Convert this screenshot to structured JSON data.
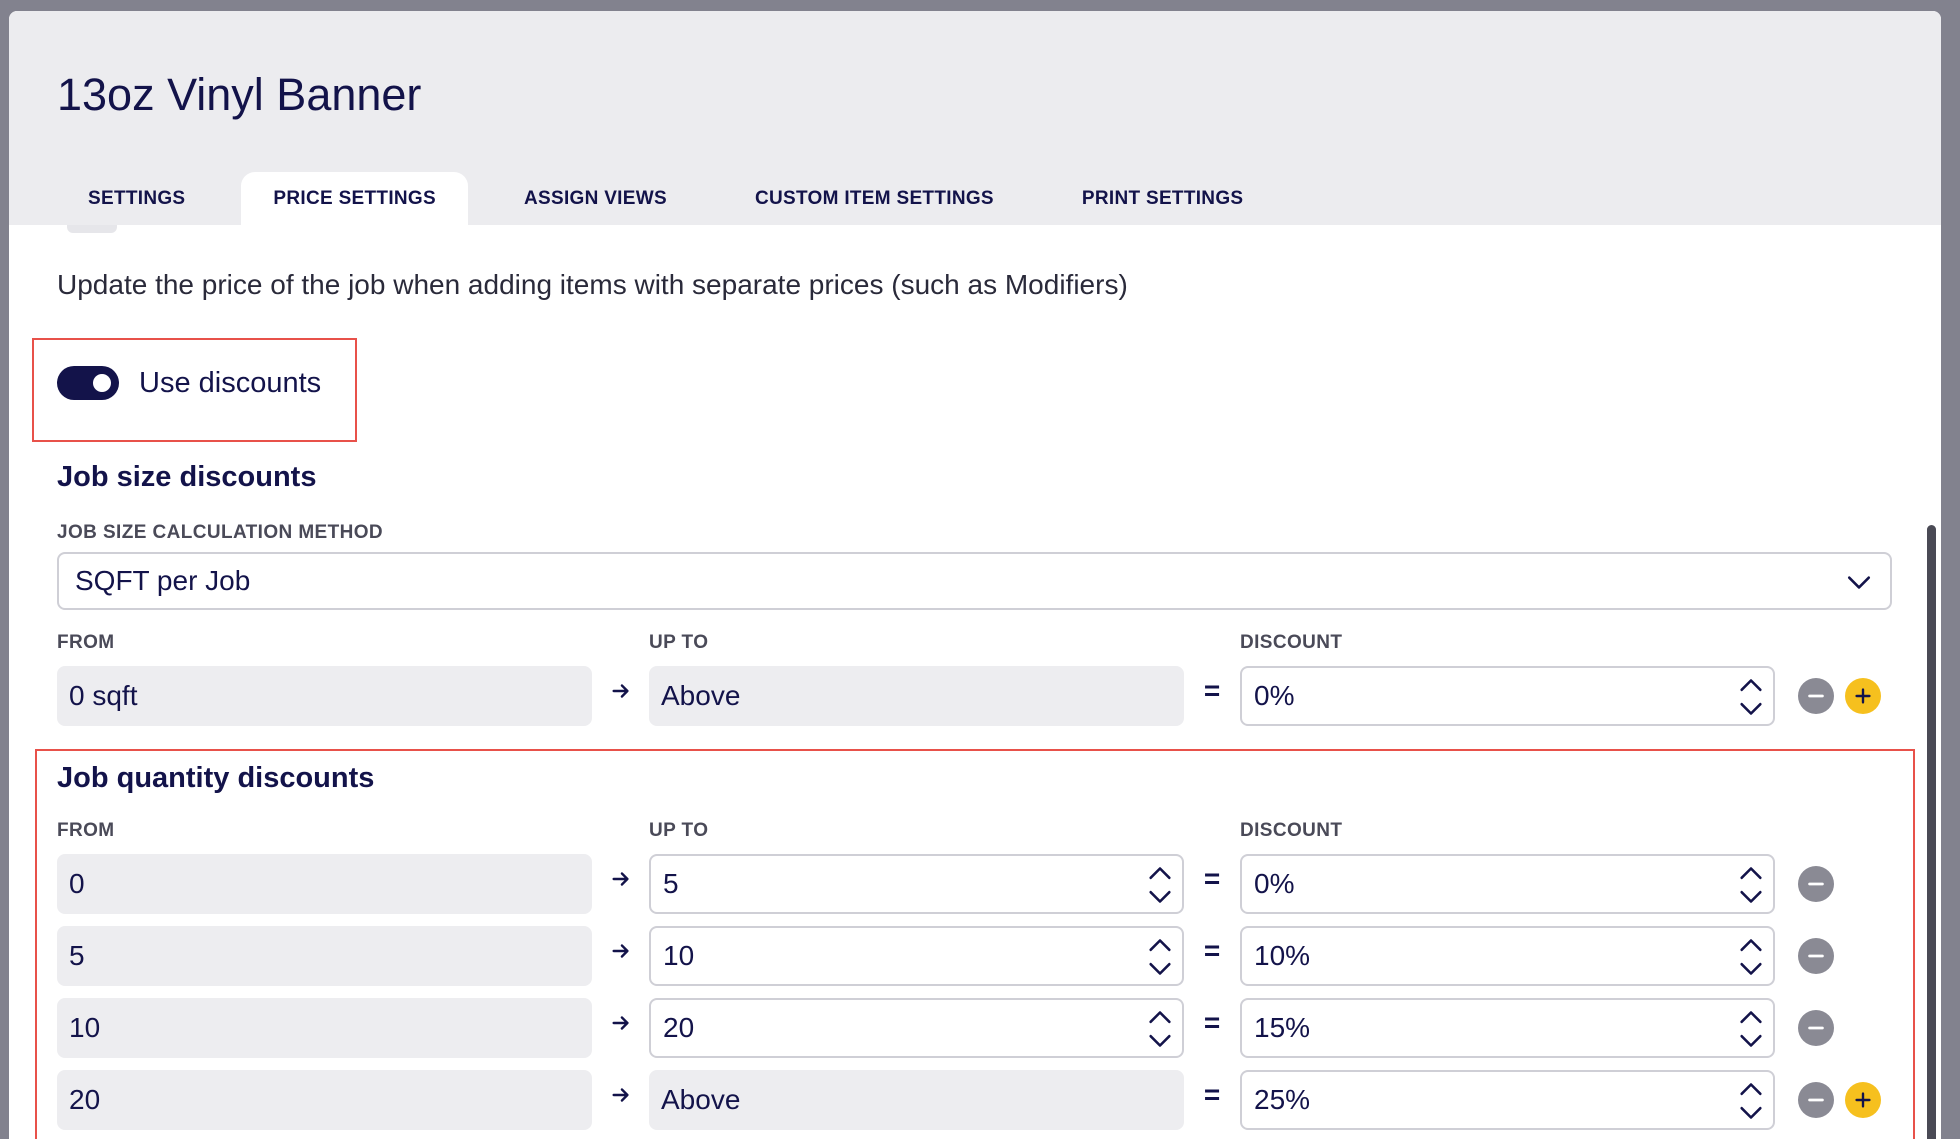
{
  "item_title": "13oz Vinyl Banner",
  "tabs": [
    "SETTINGS",
    "PRICE SETTINGS",
    "ASSIGN VIEWS",
    "CUSTOM ITEM SETTINGS",
    "PRINT SETTINGS"
  ],
  "active_tab": "PRICE SETTINGS",
  "description": "Update the price of the job when adding items with separate prices (such as Modifiers)",
  "use_discounts": {
    "label": "Use discounts",
    "enabled": true
  },
  "job_size": {
    "title": "Job size discounts",
    "method_label": "JOB SIZE CALCULATION METHOD",
    "method_value": "SQFT per Job",
    "col_from": "FROM",
    "col_up_to": "UP TO",
    "col_discount": "DISCOUNT",
    "rows": [
      {
        "from": "0 sqft",
        "up_to": "Above",
        "discount": "0%"
      }
    ]
  },
  "job_quantity": {
    "title": "Job quantity discounts",
    "col_from": "FROM",
    "col_up_to": "UP TO",
    "col_discount": "DISCOUNT",
    "rows": [
      {
        "from": "0",
        "up_to": "5",
        "discount": "0%"
      },
      {
        "from": "5",
        "up_to": "10",
        "discount": "10%"
      },
      {
        "from": "10",
        "up_to": "20",
        "discount": "15%"
      },
      {
        "from": "20",
        "up_to": "Above",
        "discount": "25%"
      }
    ]
  },
  "symbols": {
    "equals": "="
  },
  "colors": {
    "primary": "#13134a",
    "highlight": "#e8514a",
    "add_button": "#f6c01e",
    "remove_button": "#8a8a94"
  }
}
